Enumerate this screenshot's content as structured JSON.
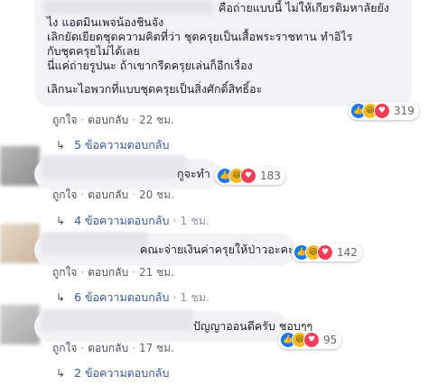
{
  "comments": [
    {
      "text_lines": [
        "คือถ่ายแบบนี้ ไม่ให้เกียรติมหาลัยยัง",
        "ไง แอดมินเพจน้องชินจัง",
        "เลิกยัดเยียดชุดความคิดที่ว่า ชุดครุยเป็นเสื้อพระราชทาน ทำอิไร",
        "กับชุดครุยไม่ได้เลย",
        "นี่แค่ถ่ายรูปนะ ถ้าเขากรีดครุยเล่นก็อีกเรื่อง",
        "",
        "เลิกนะไอพวกที่แบบชุดครุยเป็นสิ่งศักดิ์สิทธิ์อะ"
      ],
      "like_label": "ถูกใจ",
      "reply_label": "ตอบกลับ",
      "time": "22 ชม.",
      "reaction_count": "319",
      "replies_label": "5 ข้อความตอบกลับ",
      "replies_time": ""
    },
    {
      "text_lines": [
        "กูจะทำ"
      ],
      "like_label": "ถูกใจ",
      "reply_label": "ตอบกลับ",
      "time": "20 ชม.",
      "reaction_count": "183",
      "replies_label": "4 ข้อความตอบกลับ",
      "replies_time": "1 ชม."
    },
    {
      "text_lines": [
        "คณะจ่ายเงินค่าครุยให้ป่าวอะคะ??"
      ],
      "like_label": "ถูกใจ",
      "reply_label": "ตอบกลับ",
      "time": "21 ชม.",
      "reaction_count": "142",
      "replies_label": "6 ข้อความตอบกลับ",
      "replies_time": "1 ชม."
    },
    {
      "text_lines": [
        "ปัญญาออนดีครับ ชอบๆๆ"
      ],
      "like_label": "ถูกใจ",
      "reply_label": "ตอบกลับ",
      "time": "17 ชม.",
      "reaction_count": "95",
      "replies_label": "2 ข้อความตอบกลับ",
      "replies_time": ""
    }
  ],
  "icons": {
    "reply_arrow": "reply-arrow-icon",
    "like": "like-reaction-icon",
    "haha": "haha-reaction-icon",
    "love": "love-reaction-icon"
  },
  "colors": {
    "bubble": "#f2f3f5",
    "link": "#385898",
    "like": "#1877f2",
    "haha": "#f7b928",
    "love": "#f33e58"
  }
}
